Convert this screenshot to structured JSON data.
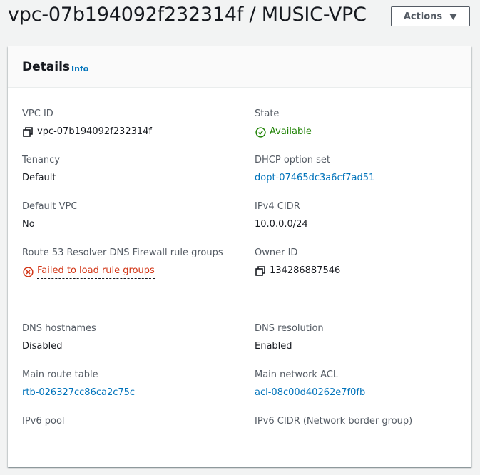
{
  "header": {
    "title": "vpc-07b194092f232314f / MUSIC-VPC",
    "actions_label": "Actions"
  },
  "details": {
    "title": "Details",
    "info_label": "Info",
    "left": [
      {
        "label": "VPC ID",
        "value": "vpc-07b194092f232314f",
        "kind": "copy"
      },
      {
        "label": "Tenancy",
        "value": "Default",
        "kind": "text"
      },
      {
        "label": "Default VPC",
        "value": "No",
        "kind": "text"
      },
      {
        "label": "Route 53 Resolver DNS Firewall rule groups",
        "value": "Failed to load rule groups",
        "kind": "error"
      }
    ],
    "right": [
      {
        "label": "State",
        "value": "Available",
        "kind": "status"
      },
      {
        "label": "DHCP option set",
        "value": "dopt-07465dc3a6cf7ad51",
        "kind": "link"
      },
      {
        "label": "IPv4 CIDR",
        "value": "10.0.0.0/24",
        "kind": "text"
      },
      {
        "label": "Owner ID",
        "value": "134286887546",
        "kind": "copy"
      }
    ],
    "left2": [
      {
        "label": "DNS hostnames",
        "value": "Disabled",
        "kind": "text"
      },
      {
        "label": "Main route table",
        "value": "rtb-026327cc86ca2c75c",
        "kind": "link"
      },
      {
        "label": "IPv6 pool",
        "value": "–",
        "kind": "text"
      }
    ],
    "right2": [
      {
        "label": "DNS resolution",
        "value": "Enabled",
        "kind": "text"
      },
      {
        "label": "Main network ACL",
        "value": "acl-08c00d40262e7f0fb",
        "kind": "link"
      },
      {
        "label": "IPv6 CIDR (Network border group)",
        "value": "–",
        "kind": "text"
      }
    ]
  },
  "colors": {
    "link": "#0073bb",
    "success": "#1d8102",
    "error": "#d13212",
    "label": "#545b64"
  },
  "icons": {
    "copy": "copy-icon",
    "status_ok": "check-circle-icon",
    "status_error": "x-circle-icon",
    "actions_caret": "caret-down-icon"
  }
}
